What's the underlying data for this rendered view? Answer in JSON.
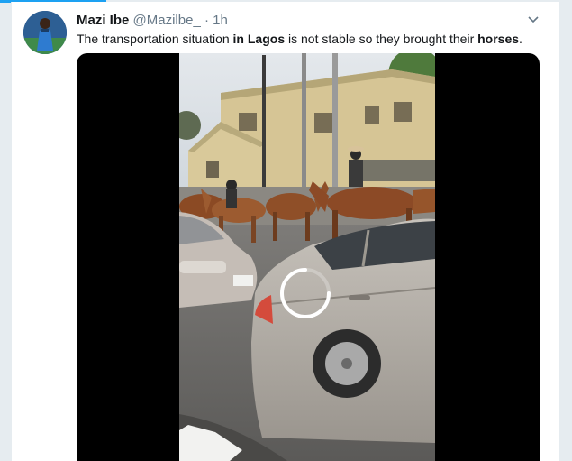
{
  "tweet": {
    "author_name": "Mazi Ibe",
    "handle": "@Mazilbe_",
    "separator": "·",
    "time": "1h",
    "text_parts": [
      "The transportation situation ",
      "in Lagos",
      " is not stable so they brought their ",
      "horses",
      "."
    ]
  },
  "media": {
    "type": "video",
    "state": "loading"
  },
  "icons": {
    "menu": "chevron-down-icon",
    "loading": "loading-spinner-icon",
    "avatar": "user-avatar"
  },
  "colors": {
    "accent": "#1da1f2",
    "text": "#14171a",
    "secondary_text": "#657786",
    "background": "#e6ecf0"
  }
}
